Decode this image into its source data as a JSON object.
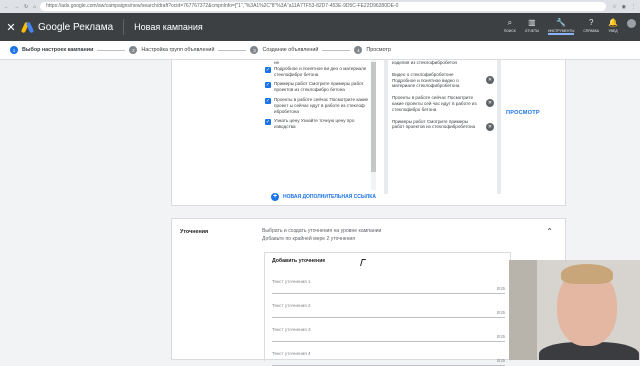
{
  "browser": {
    "url": "https://ads.google.com/aw/campaigns/new/search/draft?ocid=767767372&cmpnInfo=[\"1\",\"%3A1%2C\"8\"%3A\"a11A7TF53-82D7-453E-9D5C-FE22D96280DE-0"
  },
  "header": {
    "close_glyph": "✕",
    "logo_text": "Google Реклама",
    "campaign_title": "Новая кампания",
    "tools": [
      {
        "label": "ПОИСК",
        "icon": "search-icon",
        "glyph": "⌕"
      },
      {
        "label": "ОТЧЕТЫ",
        "icon": "reports-icon",
        "glyph": "▥"
      },
      {
        "label": "ИНСТРУМЕНТЫ",
        "icon": "wrench-icon",
        "glyph": "🔧"
      },
      {
        "label": "СПРАВКА",
        "icon": "help-icon",
        "glyph": "?"
      },
      {
        "label": "УВЕД",
        "icon": "bell-icon",
        "glyph": "🔔"
      }
    ]
  },
  "steps": [
    {
      "num": "1",
      "label": "Выбор настроек кампании"
    },
    {
      "num": "2",
      "label": "Настройка групп объявлений"
    },
    {
      "num": "3",
      "label": "Создание объявлений"
    },
    {
      "num": "4",
      "label": "Просмотр"
    }
  ],
  "sitelinks": [
    {
      "text": "не"
    },
    {
      "text": "Подробное и понятное ви део о материале стеклофибро бетона"
    },
    {
      "text": "Примеры работ Смотрите примеры работ проектов из стеклофибро бетона"
    },
    {
      "text": "Проекты в работе сейчас Посмотрите какие проект ы сейчас идут в работе из стеклоф ибробетона"
    },
    {
      "text": "Узнать цену Узнайте точную цену про изводства"
    }
  ],
  "preview": [
    {
      "text": "изделия из стеклофибробетон"
    },
    {
      "text": "Видео о стеклофибробетоне Подробное и понятное видео о материале стеклофибробетона"
    },
    {
      "text": "Проекты в работе сейчас Посмотрите какие проекты сей час идут в работе из стеклофибро бетона"
    },
    {
      "text": "Примеры работ Смотрите примеры работ проектов из стеклофибробетона"
    }
  ],
  "preview_link": "ПРОСМОТР",
  "add_sitelink": "НОВАЯ ДОПОЛНИТЕЛЬНАЯ ССЫЛКА",
  "callouts": {
    "title": "Уточнения",
    "description": "Выбрать и создать уточнения на уровне кампании",
    "hint": "Добавьте по крайней мере 2 уточнения",
    "form_title": "Добавить уточнение",
    "fields": [
      {
        "placeholder": "Текст уточнения 1",
        "count": "0/25"
      },
      {
        "placeholder": "Текст уточнения 2",
        "count": "0/25"
      },
      {
        "placeholder": "Текст уточнения 3",
        "count": "0/25"
      },
      {
        "placeholder": "Текст уточнения 4",
        "count": "0/25"
      }
    ]
  }
}
